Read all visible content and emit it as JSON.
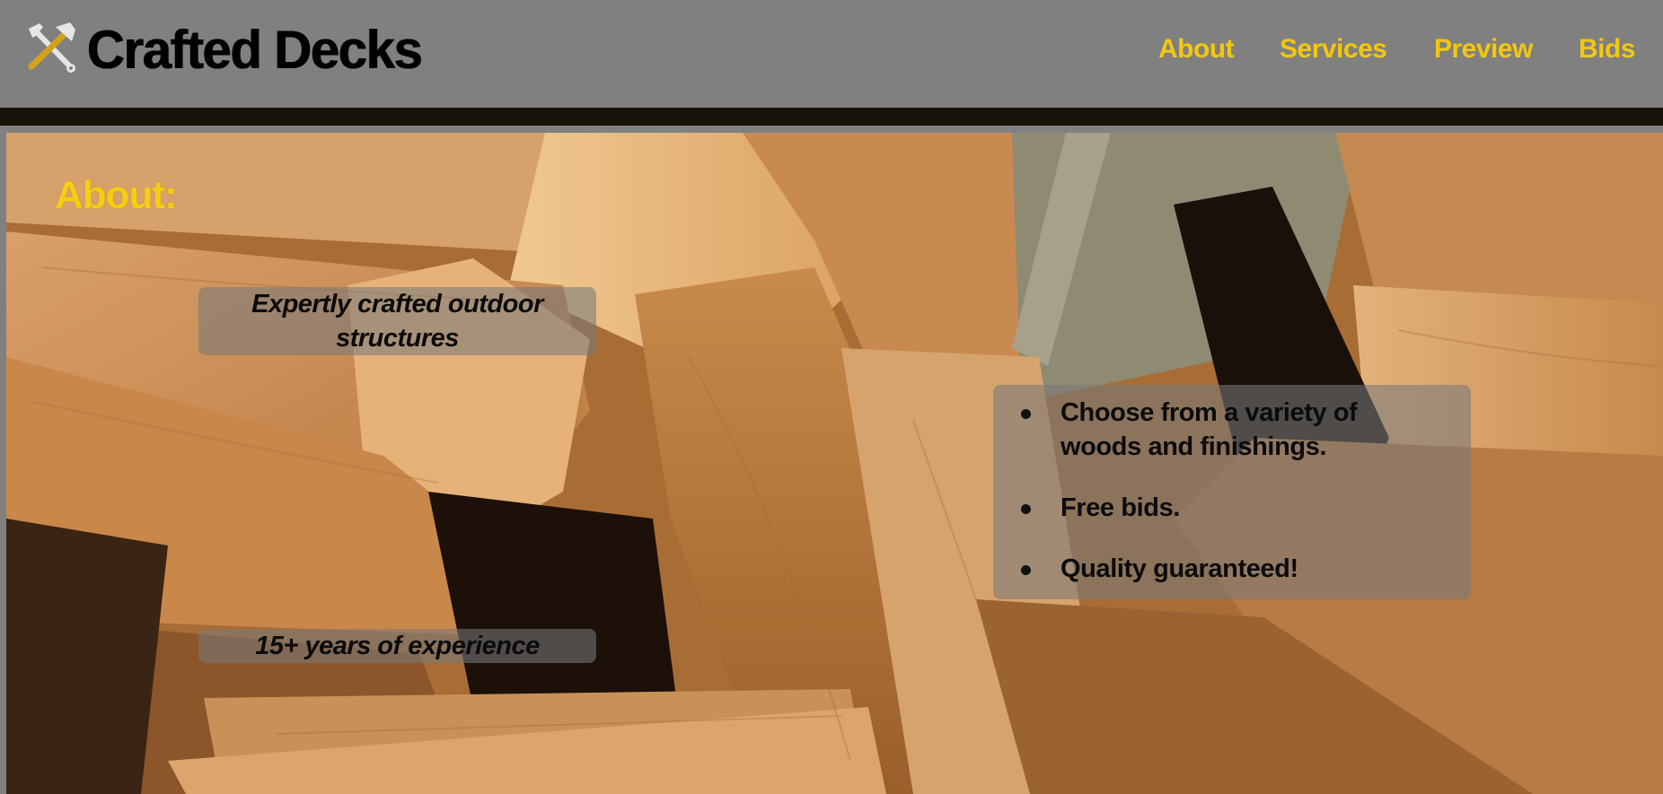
{
  "header": {
    "logo_icon": "hammer-wrench-icon",
    "brand": "Crafted Decks",
    "nav": [
      {
        "label": "About"
      },
      {
        "label": "Services"
      },
      {
        "label": "Preview"
      },
      {
        "label": "Bids"
      }
    ]
  },
  "about": {
    "title": "About:",
    "tagline": "Expertly crafted outdoor structures",
    "experience": "15+ years of experience",
    "features": [
      "Choose from a variety of woods and finishings.",
      "Free bids.",
      "Quality guaranteed!"
    ]
  },
  "colors": {
    "header_bg": "#808080",
    "nav_text": "#f4c70f",
    "heading_text": "#f7cd12",
    "divider": "#17130b",
    "panel_bg": "rgba(120,120,120,0.58)"
  }
}
